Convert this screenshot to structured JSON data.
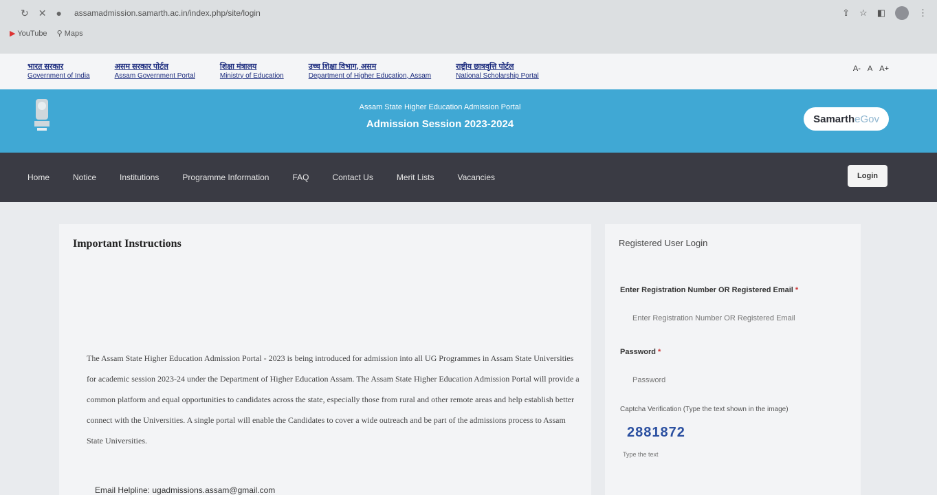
{
  "browser": {
    "url": "assamadmission.samarth.ac.in/index.php/site/login",
    "bookmarks": [
      "YouTube",
      "Maps"
    ]
  },
  "gov_links": [
    {
      "hi": "भारत सरकार",
      "en": "Government of India"
    },
    {
      "hi": "असम सरकार पोर्टल",
      "en": "Assam Government Portal"
    },
    {
      "hi": "शिक्षा मंत्रालय",
      "en": "Ministry of Education"
    },
    {
      "hi": "उच्च शिक्षा विभाग, असम",
      "en": "Department of Higher Education, Assam"
    },
    {
      "hi": "राष्ट्रीय छात्रवृत्ति पोर्टल",
      "en": "National Scholarship Portal"
    }
  ],
  "font_sizer": [
    "A-",
    "A",
    "A+"
  ],
  "banner": {
    "portal_title": "Assam State Higher Education Admission Portal",
    "session": "Admission Session 2023-2024",
    "brand": "Samarth",
    "brand_suffix": "eGov"
  },
  "nav": {
    "items": [
      "Home",
      "Notice",
      "Institutions",
      "Programme Information",
      "FAQ",
      "Contact Us",
      "Merit Lists",
      "Vacancies"
    ],
    "login": "Login"
  },
  "instructions": {
    "heading": "Important Instructions",
    "body": "The Assam State Higher Education Admission Portal - 2023 is being introduced for admission into all UG Programmes in Assam State Universities for academic session 2023-24 under the Department of Higher Education Assam. The Assam State Higher Education Admission Portal will provide a common platform and equal opportunities to candidates across the state, especially those from rural and other remote areas and help establish better connect with the Universities. A single portal will enable the Candidates to cover a wide outreach and be part of the admissions process to Assam State Universities.",
    "helpline": "Email Helpline: ugadmissions.assam@gmail.com"
  },
  "login_form": {
    "title": "Registered User Login",
    "reg_label": "Enter Registration Number OR Registered Email",
    "reg_placeholder": "Enter Registration Number OR Registered Email",
    "password_label": "Password",
    "password_placeholder": "Password",
    "required_mark": "*",
    "captcha_label": "Captcha Verification (Type the text shown in the image)",
    "captcha_text": "2881872",
    "captcha_placeholder": "Type the text"
  },
  "colors": {
    "banner": "#40a8d4",
    "navbar": "#3a3b44",
    "link": "#1a2a7d",
    "captcha": "#2a4fa0"
  }
}
